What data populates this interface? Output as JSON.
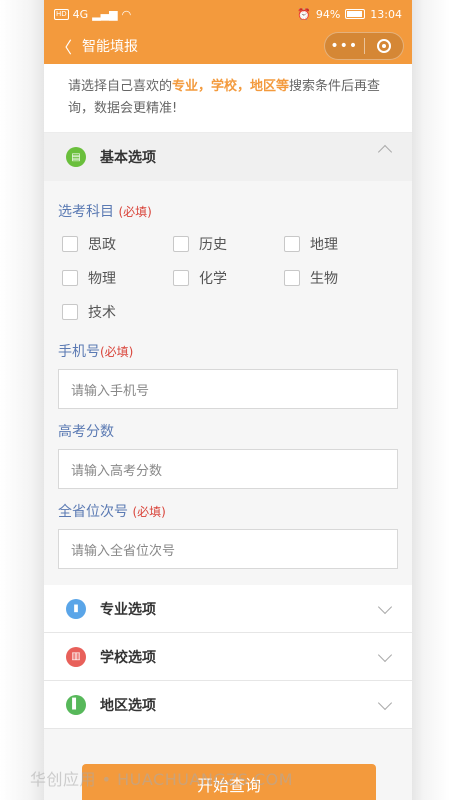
{
  "status": {
    "hd": "HD",
    "signal": "4G",
    "battery": "94%",
    "time": "13:04"
  },
  "nav": {
    "title": "智能填报",
    "more": "•••"
  },
  "notice": {
    "prefix": "请选择自己喜欢的",
    "highlight": "专业，学校，地区等",
    "suffix": "搜索条件后再查询，数据会更精准!"
  },
  "basic": {
    "title": "基本选项",
    "subjects_label": "选考科目",
    "subjects_required": "(必填)",
    "subjects": [
      "思政",
      "历史",
      "地理",
      "物理",
      "化学",
      "生物",
      "技术"
    ],
    "phone_label": "手机号",
    "phone_required": "(必填)",
    "phone_placeholder": "请输入手机号",
    "score_label": "高考分数",
    "score_placeholder": "请输入高考分数",
    "rank_label": "全省位次号",
    "rank_required": "(必填)",
    "rank_placeholder": "请输入全省位次号"
  },
  "sections": [
    {
      "title": "专业选项",
      "color": "#5aa5e8"
    },
    {
      "title": "学校选项",
      "color": "#e8605a"
    },
    {
      "title": "地区选项",
      "color": "#57b85a"
    }
  ],
  "action": {
    "start_label": "开始查询"
  },
  "watermark": "华创应用 • HUACHUANGZS.COM",
  "colors": {
    "accent": "#f39a3d",
    "label": "#5b7ab3",
    "required": "#d9443a"
  }
}
